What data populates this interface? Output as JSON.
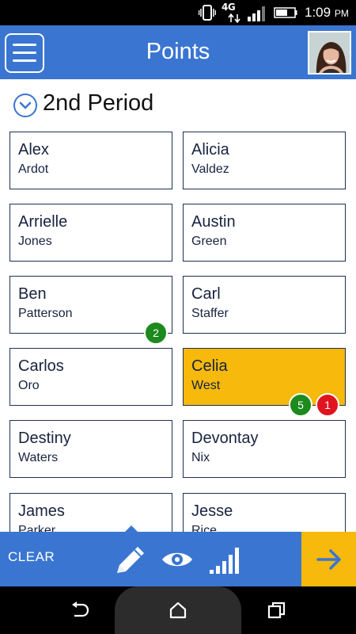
{
  "status": {
    "network": "4G",
    "time": "1:09",
    "ampm": "PM"
  },
  "header": {
    "title": "Points"
  },
  "period": {
    "title": "2nd Period"
  },
  "students": [
    {
      "first": "Alex",
      "last": "Ardot"
    },
    {
      "first": "Alicia",
      "last": "Valdez"
    },
    {
      "first": "Arrielle",
      "last": "Jones"
    },
    {
      "first": "Austin",
      "last": "Green"
    },
    {
      "first": "Ben",
      "last": "Patterson"
    },
    {
      "first": "Carl",
      "last": "Staffer"
    },
    {
      "first": "Carlos",
      "last": "Oro"
    },
    {
      "first": "Celia",
      "last": "West"
    },
    {
      "first": "Destiny",
      "last": "Waters"
    },
    {
      "first": "Devontay",
      "last": "Nix"
    },
    {
      "first": "James",
      "last": "Parker"
    },
    {
      "first": "Jesse",
      "last": "Rice"
    }
  ],
  "badges": {
    "ben_positive": "2",
    "celia_positive": "5",
    "celia_negative": "1"
  },
  "toolbar": {
    "clear_label": "CLEAR"
  },
  "colors": {
    "header": "#3a76d1",
    "selected": "#f6b90c",
    "positive": "#1c8a1c",
    "negative": "#e0141e"
  },
  "icons": [
    "menu-icon",
    "chevron-down-icon",
    "pencil-icon",
    "eye-icon",
    "signal-bars-icon",
    "arrow-right-icon",
    "back-icon",
    "home-icon",
    "recents-icon"
  ]
}
